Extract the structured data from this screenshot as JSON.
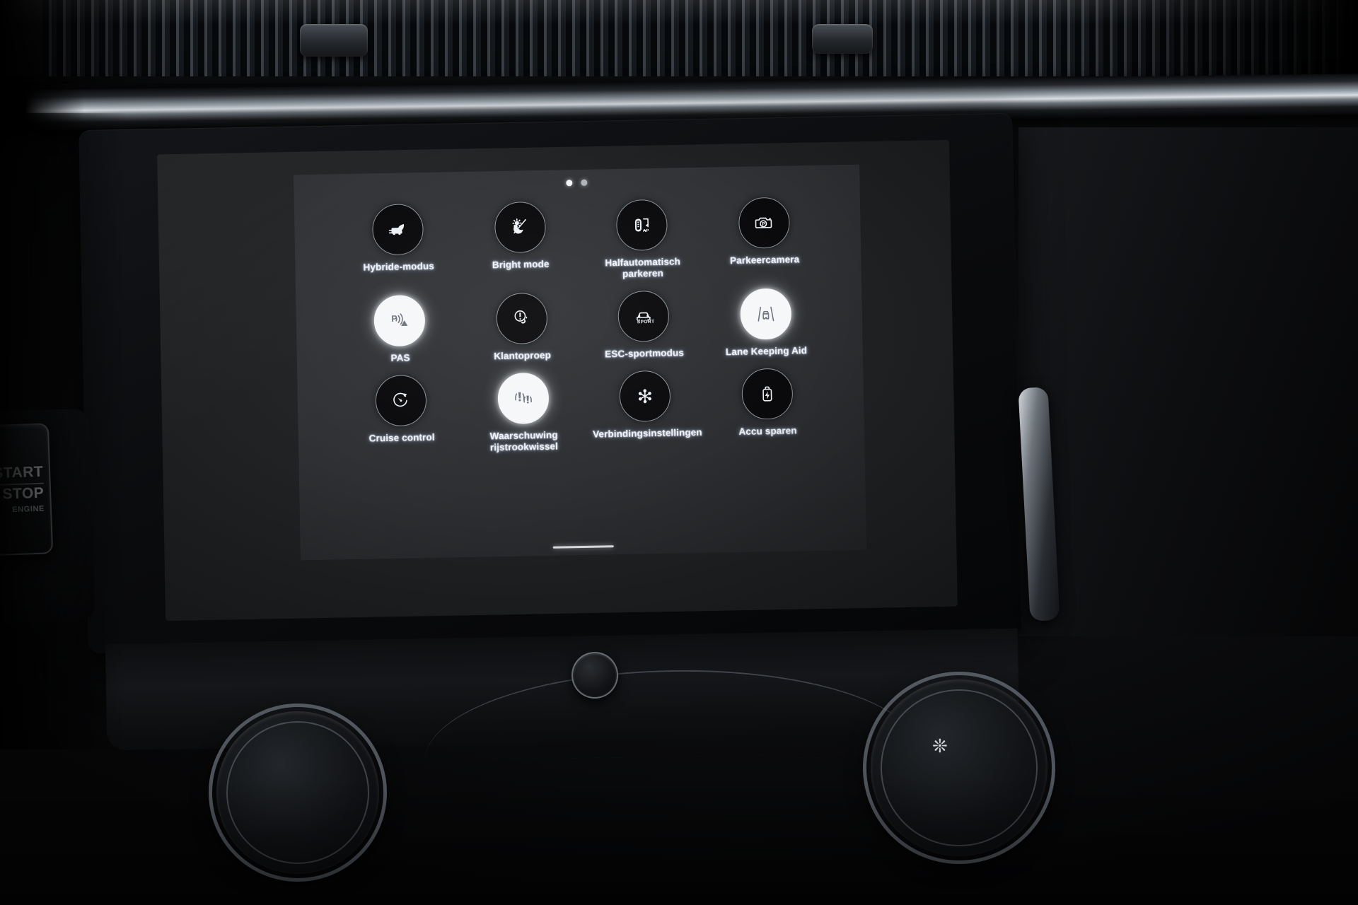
{
  "device": {
    "start_button": {
      "line1": "START",
      "line2": "STOP",
      "sub": "ENGINE"
    },
    "climate": {
      "fan_icon": "fan-icon"
    }
  },
  "screen": {
    "pagination": {
      "total": 2,
      "active_index": 0,
      "dots": [
        "dot-active",
        "dot-inactive"
      ]
    },
    "home_indicator": "home-indicator-bar",
    "colors": {
      "panel_bg": "#303235",
      "circle_off_bg": "#0a0a0c",
      "circle_off_border": "#8d9298",
      "circle_on_bg": "#f6f7f9",
      "label_text": "#eef1f6",
      "icon_off": "#eef1f5",
      "icon_on": "#6f7580"
    },
    "toggles": [
      {
        "id": "hybride-modus",
        "label": "Hybride-modus",
        "icon": "hybrid-car-leaf-icon",
        "active": false
      },
      {
        "id": "bright-mode",
        "label": "Bright mode",
        "icon": "sun-moon-brightness-icon",
        "active": false
      },
      {
        "id": "halfautomatisch-parkeren",
        "label": "Halfautomatisch parkeren",
        "icon": "semi-auto-park-icon",
        "active": false
      },
      {
        "id": "parkeercamera",
        "label": "Parkeercamera",
        "icon": "parking-camera-icon",
        "active": false
      },
      {
        "id": "pas",
        "label": "PAS",
        "icon": "park-assist-sensor-icon",
        "active": true
      },
      {
        "id": "klantoproep",
        "label": "Klantoproep",
        "icon": "customer-call-phone-icon",
        "active": false
      },
      {
        "id": "esc-sportmodus",
        "label": "ESC-sportmodus",
        "icon": "esc-sport-car-icon",
        "active": false
      },
      {
        "id": "lane-keeping-aid",
        "label": "Lane Keeping Aid",
        "icon": "lane-keeping-icon",
        "active": true
      },
      {
        "id": "cruise-control",
        "label": "Cruise control",
        "icon": "cruise-control-icon",
        "active": false
      },
      {
        "id": "waarschuwing-rijstrookwissel",
        "label": "Waarschuwing rijstrookwissel",
        "icon": "lane-change-warning-icon",
        "active": true
      },
      {
        "id": "verbindingsinstellingen",
        "label": "Verbindingsinstellingen",
        "icon": "connection-settings-icon",
        "active": false
      },
      {
        "id": "accu-sparen",
        "label": "Accu sparen",
        "icon": "battery-save-icon",
        "active": false
      }
    ]
  }
}
